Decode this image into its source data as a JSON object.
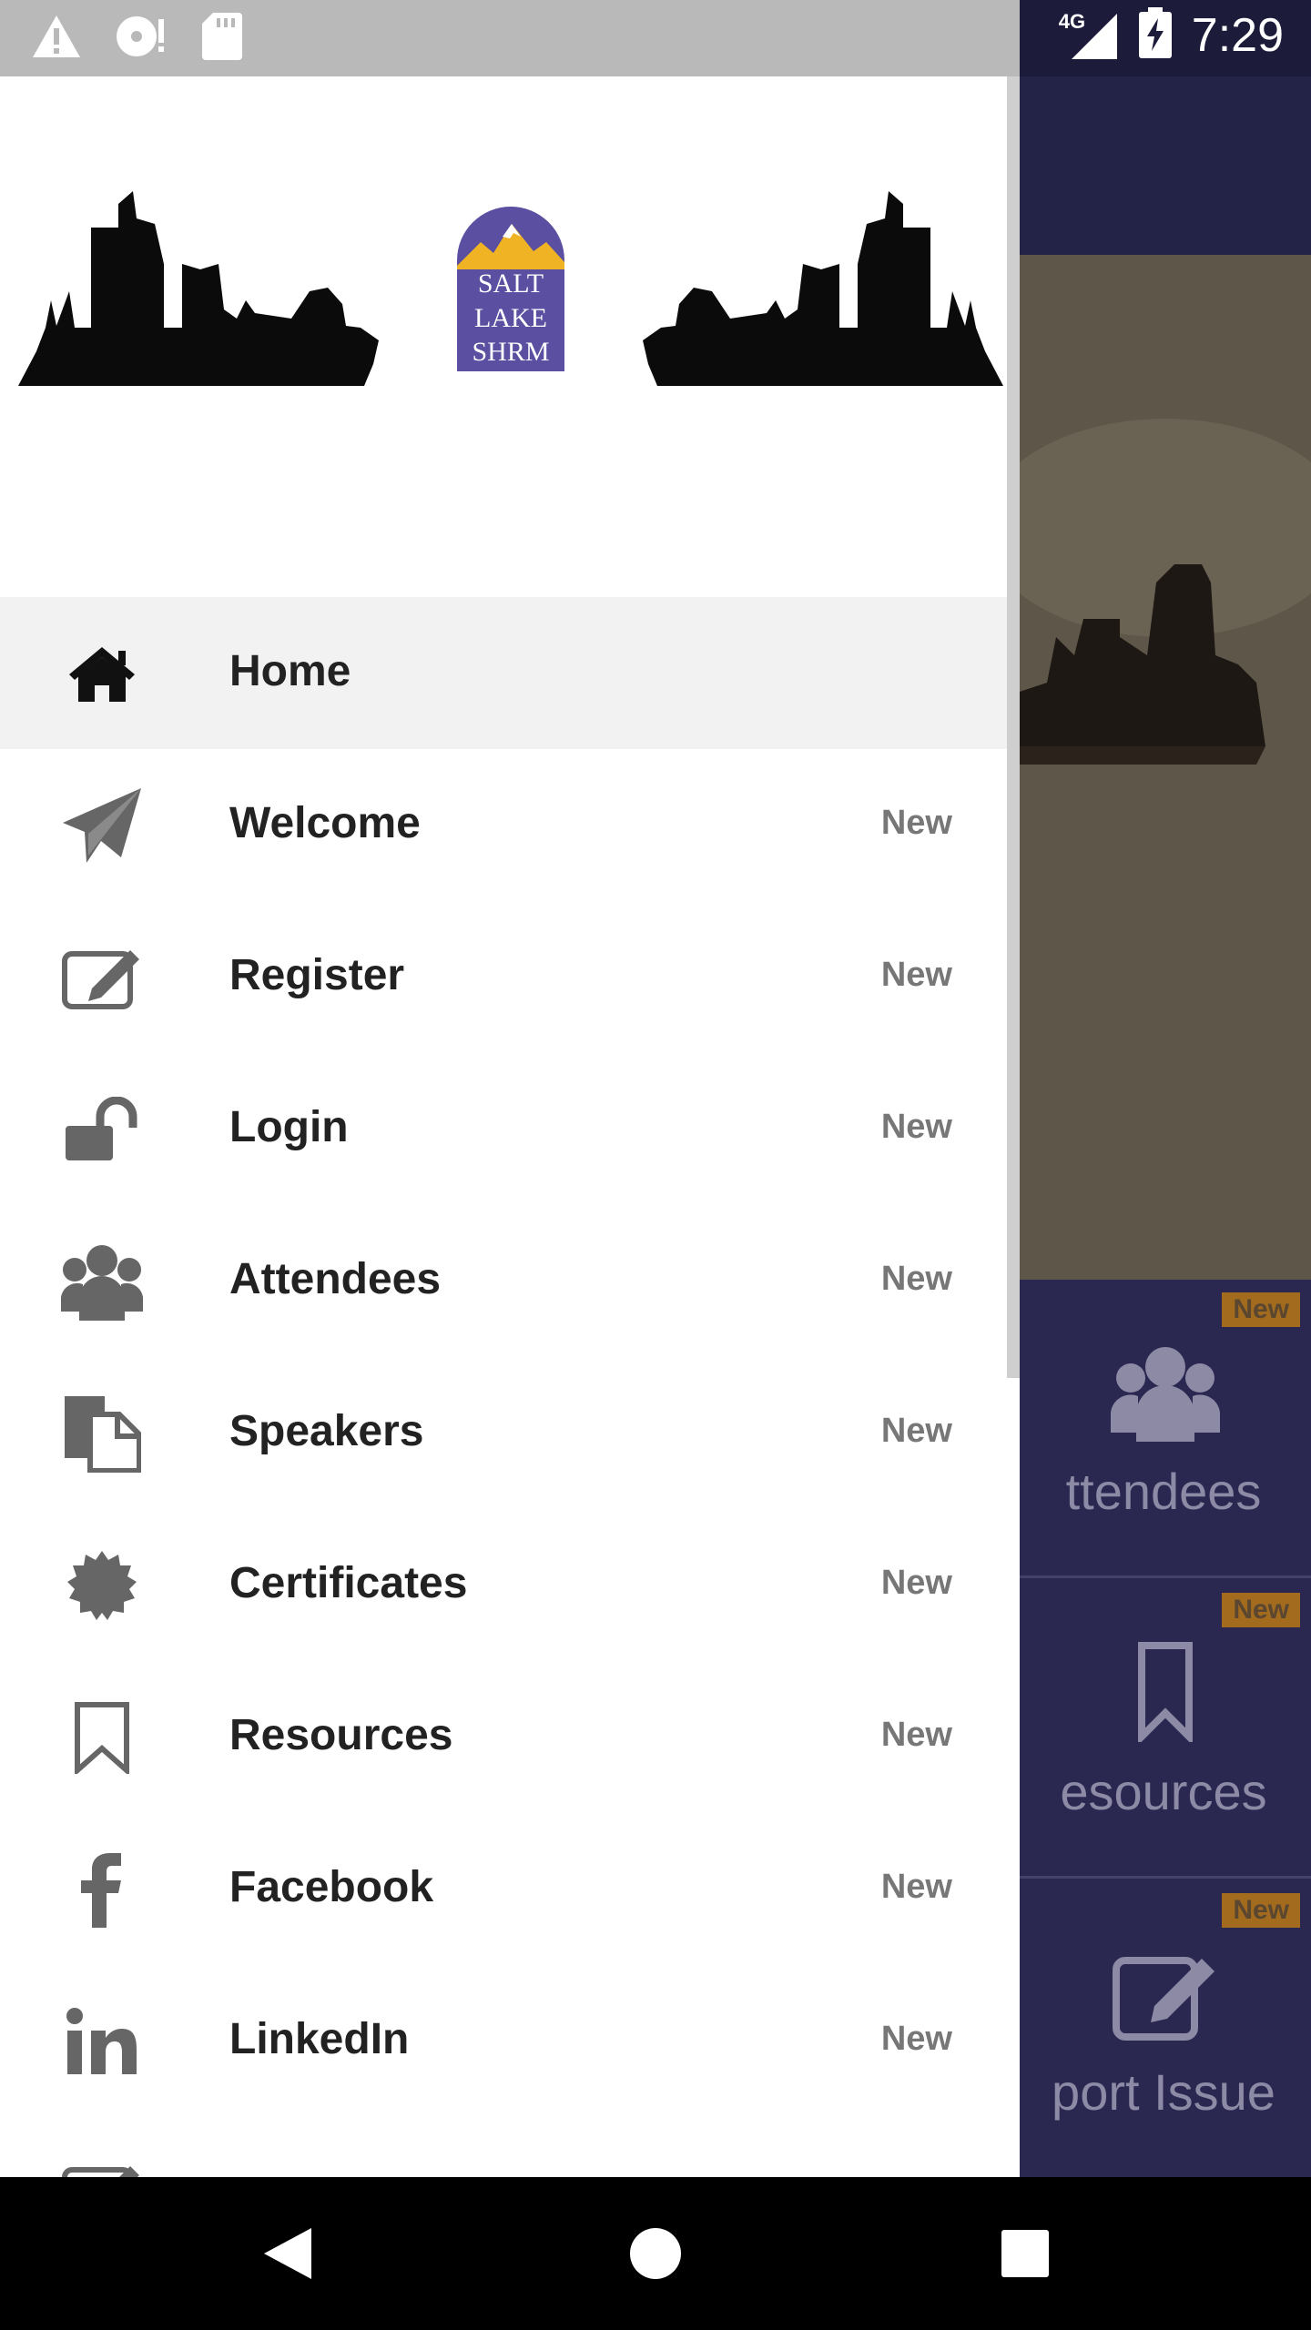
{
  "status_bar": {
    "time": "7:29",
    "network": "4G",
    "icons": [
      "warning-icon",
      "sync-alert-icon",
      "sd-card-icon",
      "signal-icon",
      "battery-charging-icon"
    ]
  },
  "drawer": {
    "logo": {
      "line1": "SALT",
      "line2": "LAKE",
      "line3": "SHRM"
    },
    "items": [
      {
        "label": "Home",
        "icon": "home-icon",
        "badge": ""
      },
      {
        "label": "Welcome",
        "icon": "paper-plane-icon",
        "badge": "New"
      },
      {
        "label": "Register",
        "icon": "edit-icon",
        "badge": "New"
      },
      {
        "label": "Login",
        "icon": "unlock-icon",
        "badge": "New"
      },
      {
        "label": "Attendees",
        "icon": "users-icon",
        "badge": "New"
      },
      {
        "label": "Speakers",
        "icon": "files-icon",
        "badge": "New"
      },
      {
        "label": "Certificates",
        "icon": "certificate-icon",
        "badge": "New"
      },
      {
        "label": "Resources",
        "icon": "bookmark-icon",
        "badge": "New"
      },
      {
        "label": "Facebook",
        "icon": "facebook-icon",
        "badge": "New"
      },
      {
        "label": "LinkedIn",
        "icon": "linkedin-icon",
        "badge": "New"
      }
    ]
  },
  "background_app": {
    "tiles": [
      {
        "label": "ttendees",
        "badge": "New",
        "icon": "users-icon"
      },
      {
        "label": "esources",
        "badge": "New",
        "icon": "bookmark-icon"
      },
      {
        "label": "port Issue",
        "badge": "New",
        "icon": "edit-icon"
      }
    ]
  },
  "colors": {
    "drawer_bg": "#ffffff",
    "active_item_bg": "#f2f2f2",
    "app_primary": "#2a2851",
    "badge_bg": "#a26b1e",
    "logo_purple": "#5a4fa0",
    "logo_gold": "#f0b323"
  }
}
